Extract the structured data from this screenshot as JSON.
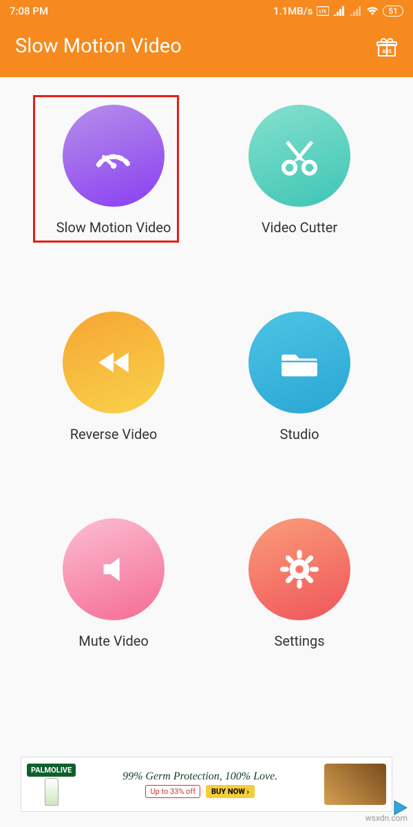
{
  "status": {
    "time": "7:08 PM",
    "speed": "1.1MB/s",
    "battery": "51"
  },
  "header": {
    "title": "Slow Motion Video"
  },
  "tiles": [
    {
      "label": "Slow Motion Video"
    },
    {
      "label": "Video Cutter"
    },
    {
      "label": "Reverse Video"
    },
    {
      "label": "Studio"
    },
    {
      "label": "Mute Video"
    },
    {
      "label": "Settings"
    }
  ],
  "banner": {
    "brand": "PALMOLIVE",
    "headline": "99% Germ Protection, 100% Love.",
    "offer": "Up to 33% off",
    "cta": "BUY NOW ›"
  },
  "watermark": "wsxdn.com"
}
